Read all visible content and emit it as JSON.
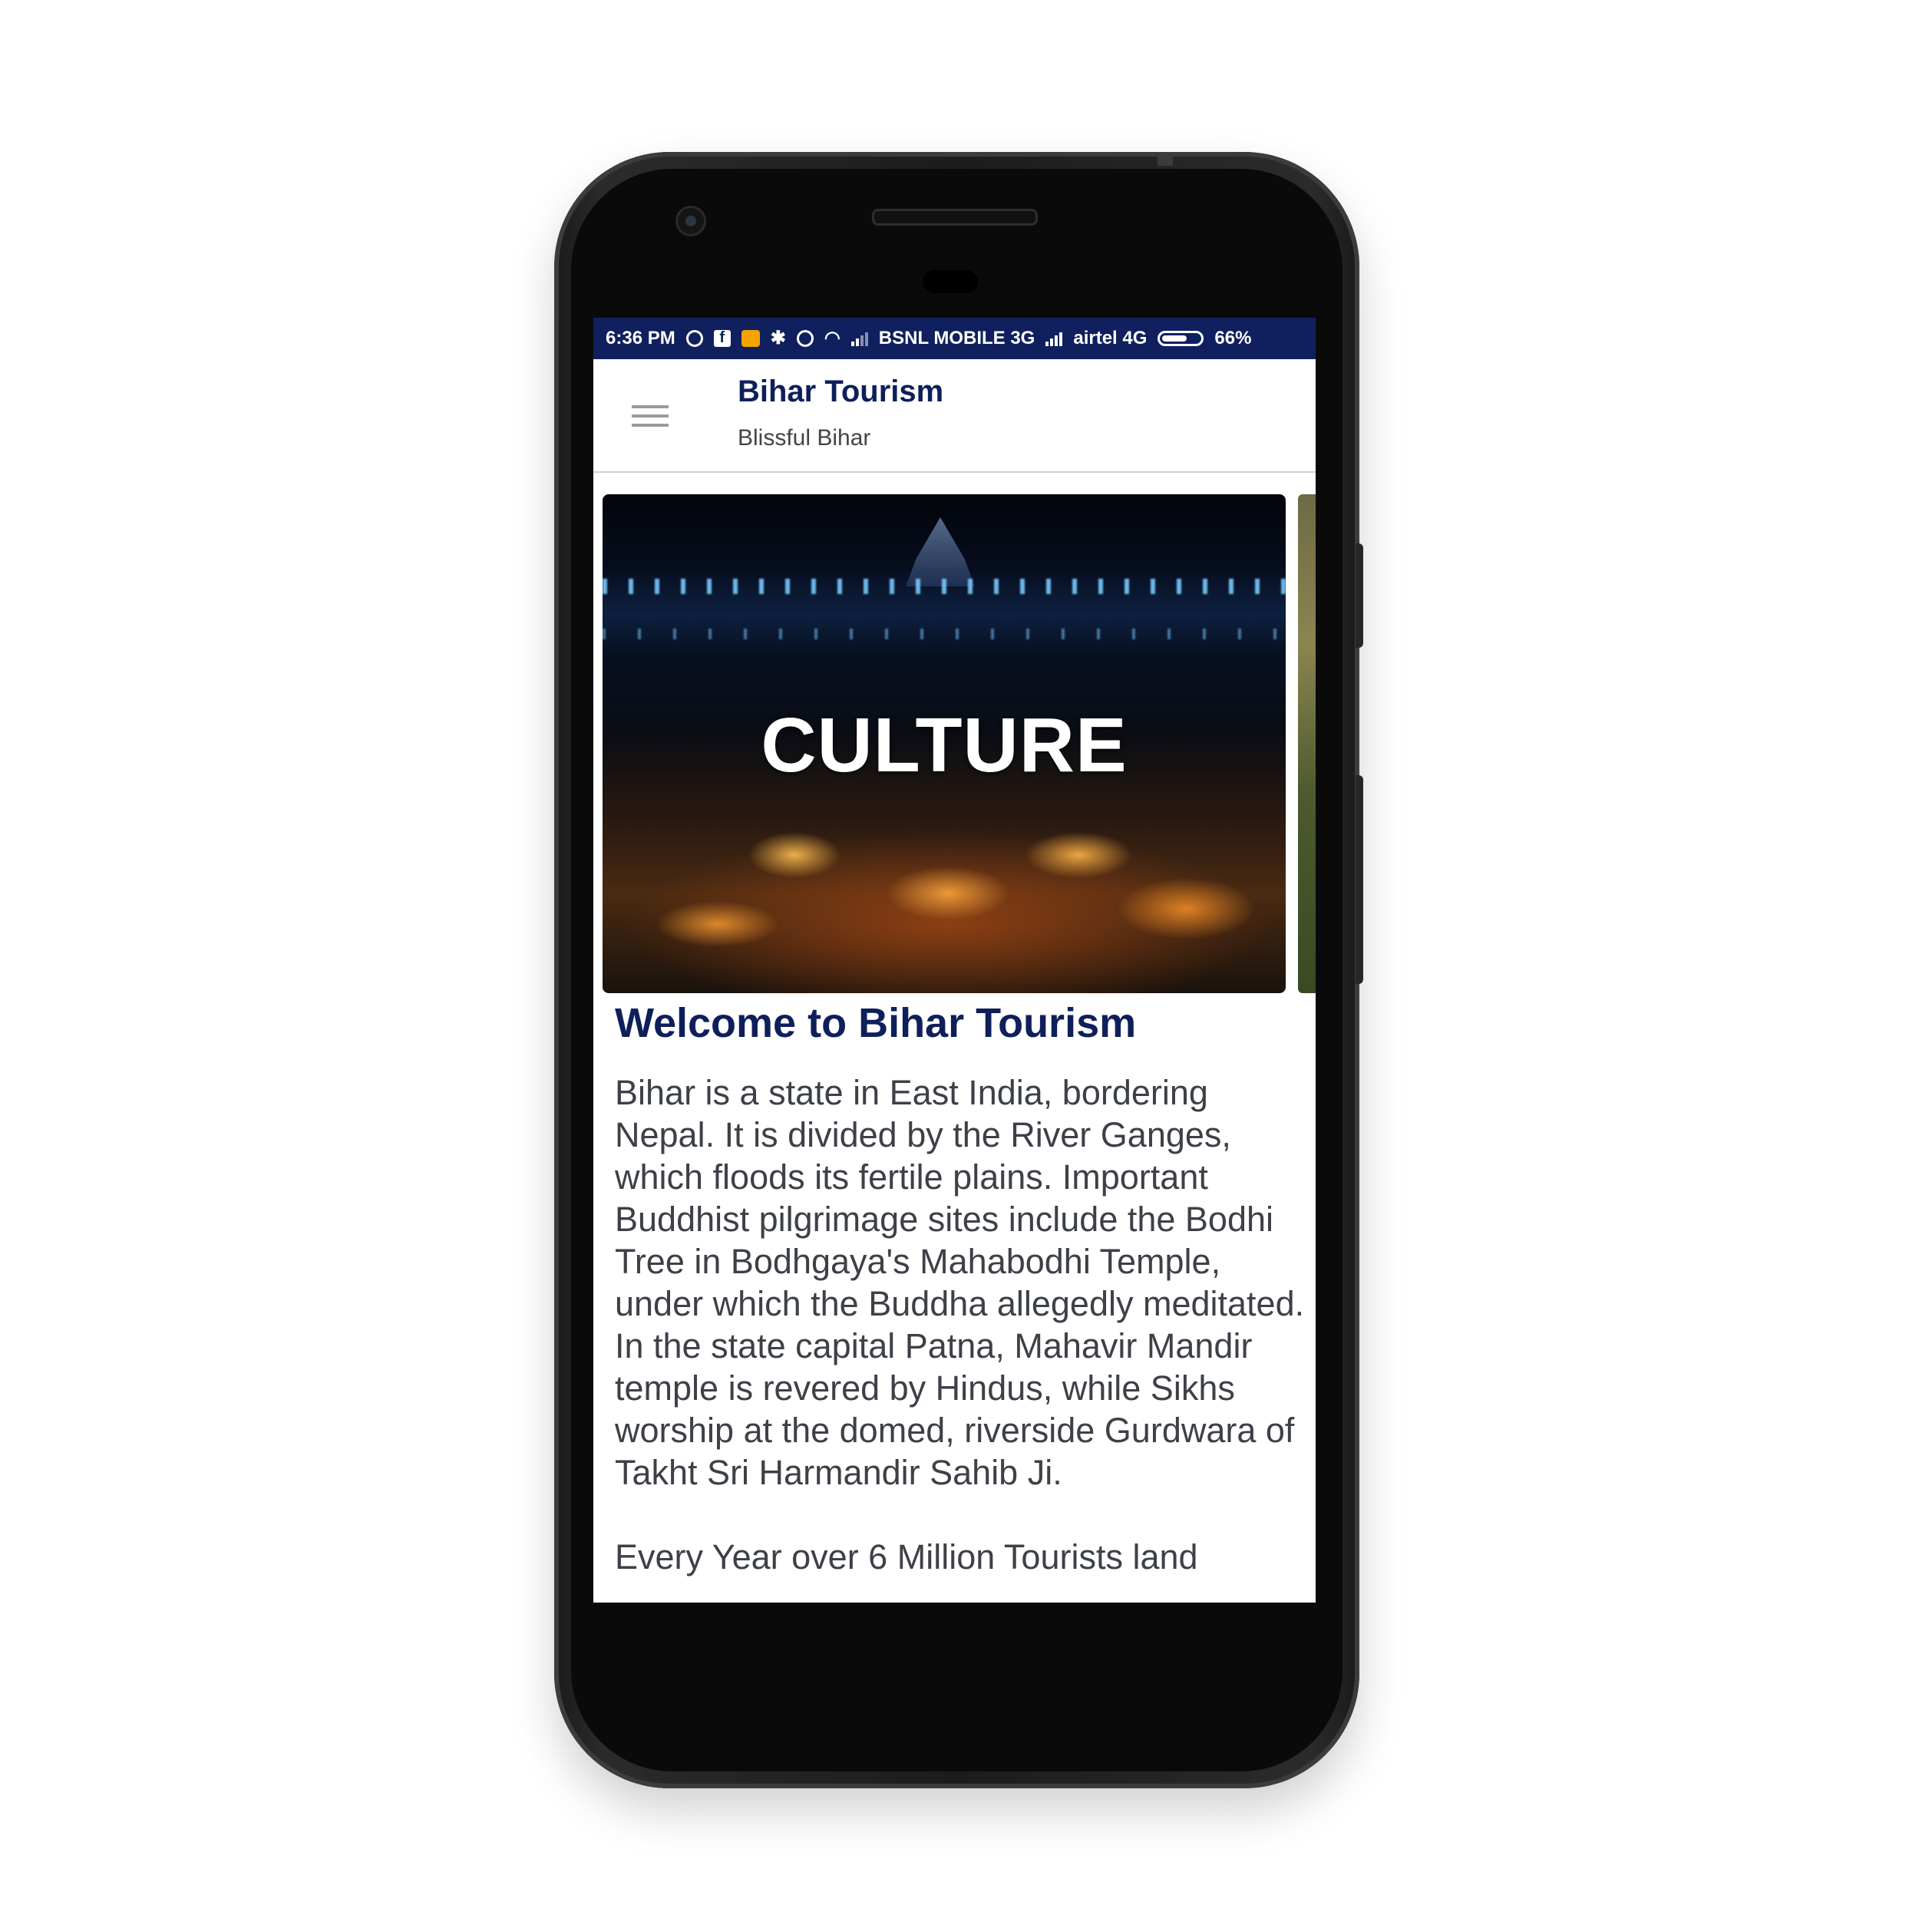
{
  "statusbar": {
    "time": "6:36 PM",
    "icons": [
      "whatsapp-icon",
      "facebook-icon",
      "message-icon",
      "bluetooth-icon",
      "alarm-icon",
      "wifi-icon",
      "signal-icon"
    ],
    "carrier1": "BSNL MOBILE 3G",
    "carrier2": "airtel 4G",
    "battery": "66%",
    "battery_level": 0.66,
    "background_color": "#10205e"
  },
  "appbar": {
    "title": "Bihar Tourism",
    "subtitle": "Blissful Bihar",
    "menu_icon": "hamburger-menu-icon",
    "title_color": "#0e1f5b"
  },
  "carousel": {
    "slides": [
      {
        "label": "CULTURE"
      }
    ]
  },
  "content": {
    "heading": "Welcome to Bihar Tourism",
    "paragraph1": "Bihar is a state in East India, bordering Nepal. It is divided by the River Ganges, which floods its fertile plains. Important Buddhist pilgrimage sites include the Bodhi Tree in Bodhgaya's Mahabodhi Temple, under which the Buddha allegedly meditated. In the state capital Patna, Mahavir Mandir temple is revered by Hindus, while Sikhs worship at the domed, riverside Gurdwara of Takht Sri Harmandir Sahib Ji.",
    "paragraph2": "Every Year over 6 Million Tourists land"
  }
}
